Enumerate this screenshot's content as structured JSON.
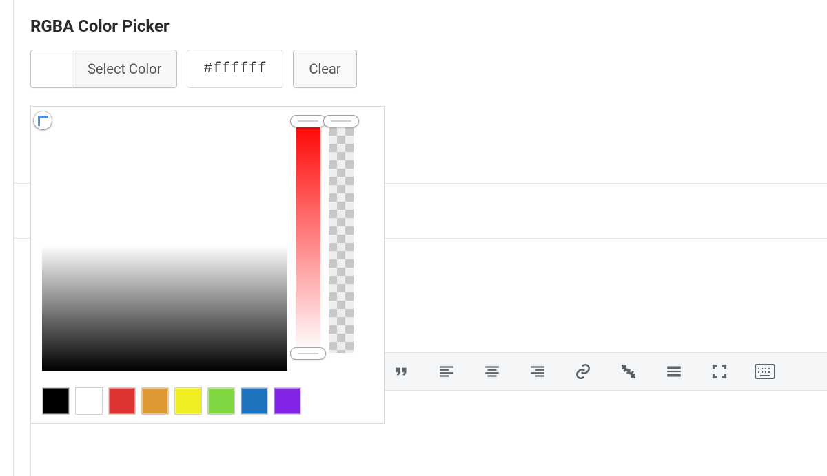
{
  "title": "RGBA Color Picker",
  "buttons": {
    "select_color": "Select Color",
    "clear": "Clear"
  },
  "hex_value": "#ffffff",
  "current_swatch_color": "#ffffff",
  "preset_swatches": [
    "#000000",
    "#ffffff",
    "#dd3333",
    "#dd9933",
    "#eeee22",
    "#81d742",
    "#1e73be",
    "#8224e3"
  ],
  "toolbar_icons": [
    "blockquote-icon",
    "align-left-icon",
    "align-center-icon",
    "align-right-icon",
    "link-icon",
    "unlink-icon",
    "read-more-icon",
    "fullscreen-icon",
    "keyboard-icon"
  ]
}
